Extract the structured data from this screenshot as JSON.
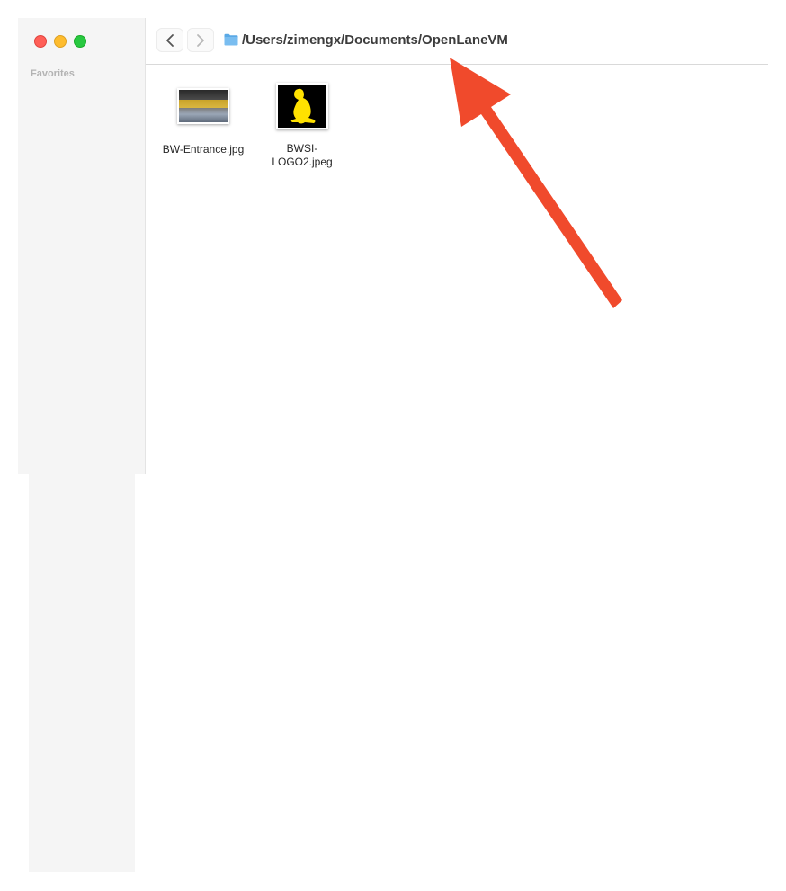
{
  "window": {
    "path_title": "/Users/zimengx/Documents/OpenLaneVM"
  },
  "sidebar": {
    "section_label": "Favorites"
  },
  "files": [
    {
      "name": "BW-Entrance.jpg",
      "kind": "photo"
    },
    {
      "name_line1": "BWSI-",
      "name_line2": "LOGO2.jpeg",
      "kind": "logo"
    }
  ],
  "colors": {
    "arrow": "#f04a2c",
    "folder": "#5aa9e6"
  },
  "icons": {
    "back": "chevron-left-icon",
    "forward": "chevron-right-icon",
    "folder": "folder-icon"
  }
}
